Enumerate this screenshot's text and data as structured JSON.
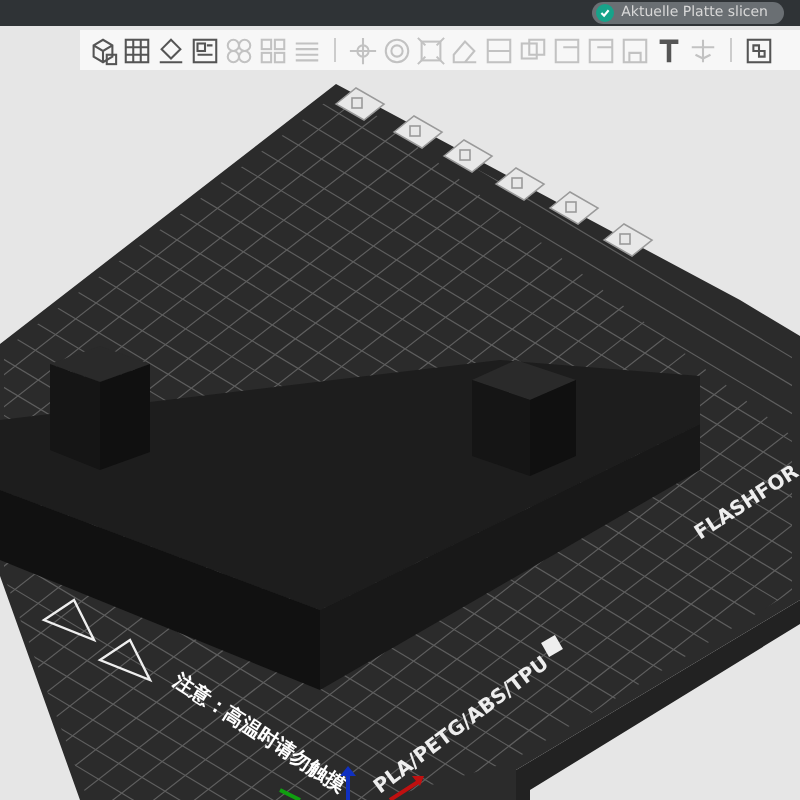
{
  "top_bar": {
    "slice_button": {
      "label": "Aktuelle Platte slicen",
      "disabled": false
    }
  },
  "toolbar": {
    "groups": [
      [
        {
          "kind": "add-cube",
          "disabled": false
        },
        {
          "kind": "grid",
          "disabled": false
        },
        {
          "kind": "orient",
          "disabled": false
        },
        {
          "kind": "arrange",
          "disabled": false
        },
        {
          "kind": "copies",
          "disabled": true
        },
        {
          "kind": "split",
          "disabled": true
        },
        {
          "kind": "layers",
          "disabled": true
        }
      ],
      [
        {
          "kind": "move",
          "disabled": true
        },
        {
          "kind": "rotate",
          "disabled": true
        },
        {
          "kind": "scale",
          "disabled": true
        },
        {
          "kind": "eraser",
          "disabled": true
        },
        {
          "kind": "cut",
          "disabled": true
        },
        {
          "kind": "boolean",
          "disabled": true
        },
        {
          "kind": "face",
          "disabled": true
        },
        {
          "kind": "face",
          "disabled": true
        },
        {
          "kind": "support",
          "disabled": true
        },
        {
          "kind": "text",
          "disabled": false
        },
        {
          "kind": "measure",
          "disabled": true
        }
      ],
      [
        {
          "kind": "assembly",
          "disabled": false
        }
      ]
    ]
  },
  "plate": {
    "brand": "FLASHFOR",
    "filaments": "PLA/PETG/ABS/TPU",
    "warning": "注意：高温时请勿触摸"
  }
}
